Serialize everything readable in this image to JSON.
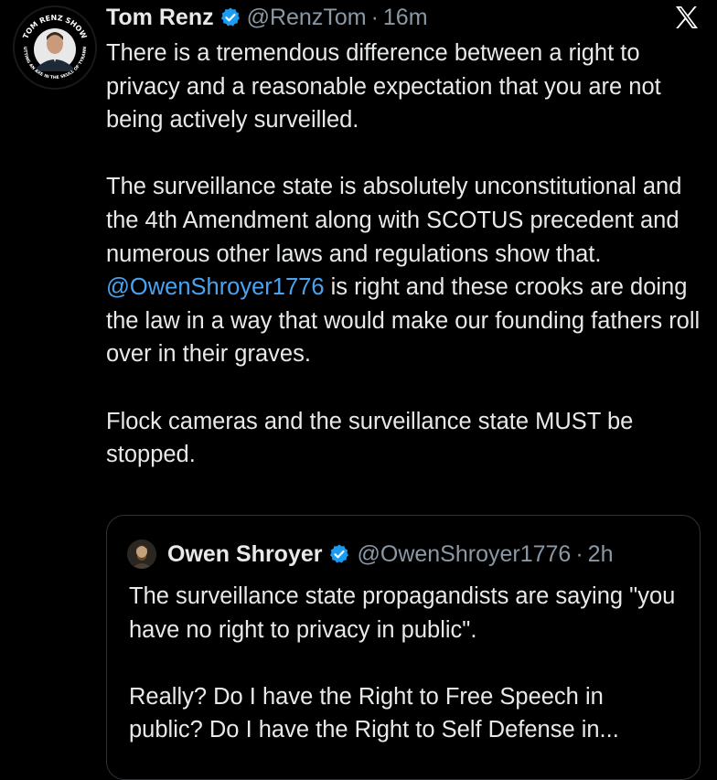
{
  "tweet": {
    "author_name": "Tom Renz",
    "handle": "@RenzTom",
    "separator": "·",
    "time": "16m",
    "avatar_text_top": "TOM RENZ SHOW",
    "avatar_text_bottom": "PUTTING AN AXE IN THE SKULL OF TYRANNY",
    "paragraphs": {
      "p1": "There is a tremendous difference between a right to privacy and a reasonable expectation that you are not being actively surveilled.",
      "p2_before": "The surveillance state is absolutely unconstitutional and the 4th Amendment along with SCOTUS precedent and numerous other laws and regulations show that. ",
      "p2_mention": "@OwenShroyer1776",
      "p2_after": " is right and these crooks are doing the law in a way that would make our founding fathers roll over in their graves.",
      "p3": "Flock cameras and the surveillance state MUST be stopped."
    }
  },
  "quoted_tweet": {
    "author_name": "Owen Shroyer",
    "handle": "@OwenShroyer1776",
    "separator": "·",
    "time": "2h",
    "paragraphs": {
      "p1": "The surveillance state propagandists are saying \"you have no right to privacy in public\".",
      "p2": "Really? Do I have the Right to Free Speech in public? Do I have the Right to Self Defense in..."
    }
  },
  "colors": {
    "background": "#000000",
    "text": "#e7e9ea",
    "muted": "#8b98a5",
    "mention": "#4aa3f0",
    "verified": "#1d9bf0",
    "border": "#2f3336"
  },
  "icons": {
    "verified": "verified-badge-icon",
    "brand": "x-logo-icon"
  }
}
